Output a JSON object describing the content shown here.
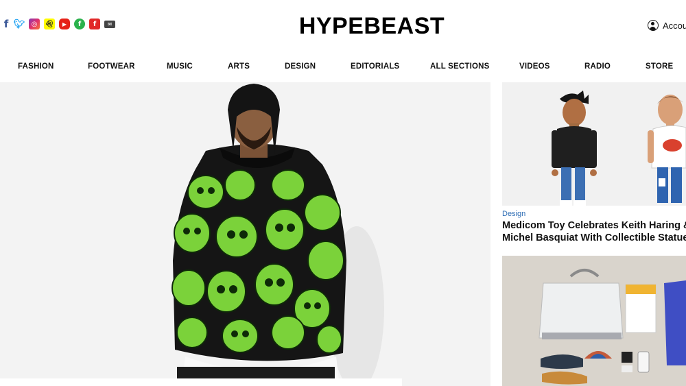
{
  "header": {
    "logo": "HYPEBEAST",
    "account_label": "Account",
    "social_icons": [
      "facebook-icon",
      "twitter-icon",
      "instagram-icon",
      "snapchat-icon",
      "youtube-icon",
      "feedly-icon",
      "flipboard-icon",
      "mail-icon"
    ]
  },
  "nav": {
    "items": [
      {
        "label": "FASHION"
      },
      {
        "label": "FOOTWEAR"
      },
      {
        "label": "MUSIC"
      },
      {
        "label": "ARTS"
      },
      {
        "label": "DESIGN"
      },
      {
        "label": "EDITORIALS"
      },
      {
        "label": "ALL SECTIONS"
      },
      {
        "label": "VIDEOS"
      },
      {
        "label": "RADIO"
      },
      {
        "label": "STORE"
      }
    ]
  },
  "sidebar": {
    "articles": [
      {
        "category": "Design",
        "title_line1": "Medicom Toy Celebrates Keith Haring & Je",
        "title_line2": "Michel Basquiat With Collectible Statues"
      }
    ]
  },
  "colors": {
    "accent_link": "#2f6eb5",
    "jacket_green": "#7bd23a",
    "background": "#ffffff"
  }
}
